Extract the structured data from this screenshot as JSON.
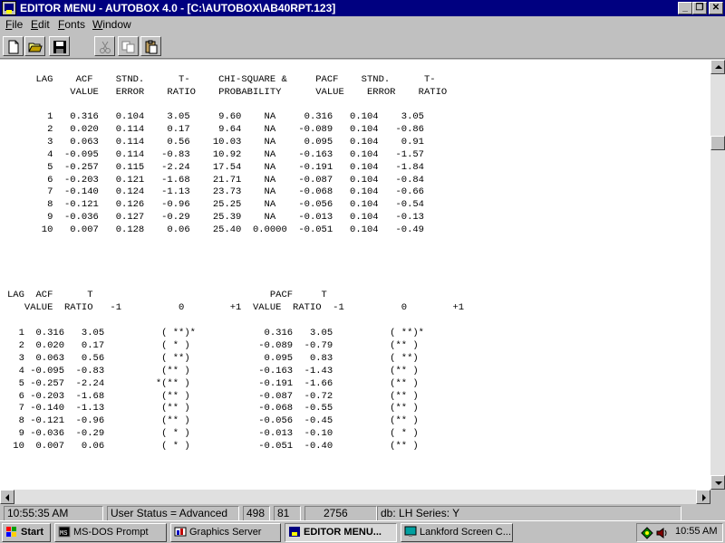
{
  "window": {
    "title": "EDITOR MENU - AUTOBOX 4.0 - [C:\\AUTOBOX\\AB40RPT.123]",
    "minimize_label": "_",
    "maximize_label": "❐",
    "close_label": "✕"
  },
  "menu": [
    {
      "accel": "F",
      "rest": "ile"
    },
    {
      "accel": "E",
      "rest": "dit"
    },
    {
      "accel": "F",
      "rest": "onts"
    },
    {
      "accel": "W",
      "rest": "indow"
    }
  ],
  "toolbar": {
    "icons": [
      "new-file-icon",
      "open-folder-icon",
      "save-disk-icon",
      "cut-scissors-icon",
      "copy-icon",
      "paste-icon"
    ]
  },
  "report": {
    "block1_header": "     LAG    ACF    STND.      T-     CHI-SQUARE &     PACF    STND.      T-\n           VALUE   ERROR    RATIO    PROBABILITY      VALUE    ERROR    RATIO",
    "block1_rows": "       1   0.316   0.104    3.05     9.60    NA     0.316   0.104    3.05\n       2   0.020   0.114    0.17     9.64    NA    -0.089   0.104   -0.86\n       3   0.063   0.114    0.56    10.03    NA     0.095   0.104    0.91\n       4  -0.095   0.114   -0.83    10.92    NA    -0.163   0.104   -1.57\n       5  -0.257   0.115   -2.24    17.54    NA    -0.191   0.104   -1.84\n       6  -0.203   0.121   -1.68    21.71    NA    -0.087   0.104   -0.84\n       7  -0.140   0.124   -1.13    23.73    NA    -0.068   0.104   -0.66\n       8  -0.121   0.126   -0.96    25.25    NA    -0.056   0.104   -0.54\n       9  -0.036   0.127   -0.29    25.39    NA    -0.013   0.104   -0.13\n      10   0.007   0.128    0.06    25.40  0.0000  -0.051   0.104   -0.49",
    "block2_header": "LAG  ACF      T                               PACF     T\n   VALUE  RATIO   -1          0        +1  VALUE  RATIO  -1          0        +1",
    "block2_rows": "  1  0.316   3.05          ( **)*            0.316   3.05          ( **)*\n  2  0.020   0.17          ( * )            -0.089  -0.79          (** )\n  3  0.063   0.56          ( **)             0.095   0.83          ( **)\n  4 -0.095  -0.83          (** )            -0.163  -1.43          (** )\n  5 -0.257  -2.24         *(** )            -0.191  -1.66          (** )\n  6 -0.203  -1.68          (** )            -0.087  -0.72          (** )\n  7 -0.140  -1.13          (** )            -0.068  -0.55          (** )\n  8 -0.121  -0.96          (** )            -0.056  -0.45          (** )\n  9 -0.036  -0.29          ( * )            -0.013  -0.10          ( * )\n 10  0.007   0.06          ( * )            -0.051  -0.40          (** )"
  },
  "status": {
    "time": "10:55:35 AM",
    "user_status": "User Status = Advanced",
    "line": "498",
    "column": "81",
    "count": "2756",
    "db_series": "db: LH Series: Y"
  },
  "taskbar": {
    "start": "Start",
    "tasks": [
      "MS-DOS Prompt",
      "Graphics Server",
      "EDITOR MENU...",
      "Lankford Screen C..."
    ],
    "clock": "10:55 AM"
  },
  "colors": {
    "title_bar": "#000080",
    "face": "#c0c0c0",
    "content_bg": "#ffffff"
  }
}
